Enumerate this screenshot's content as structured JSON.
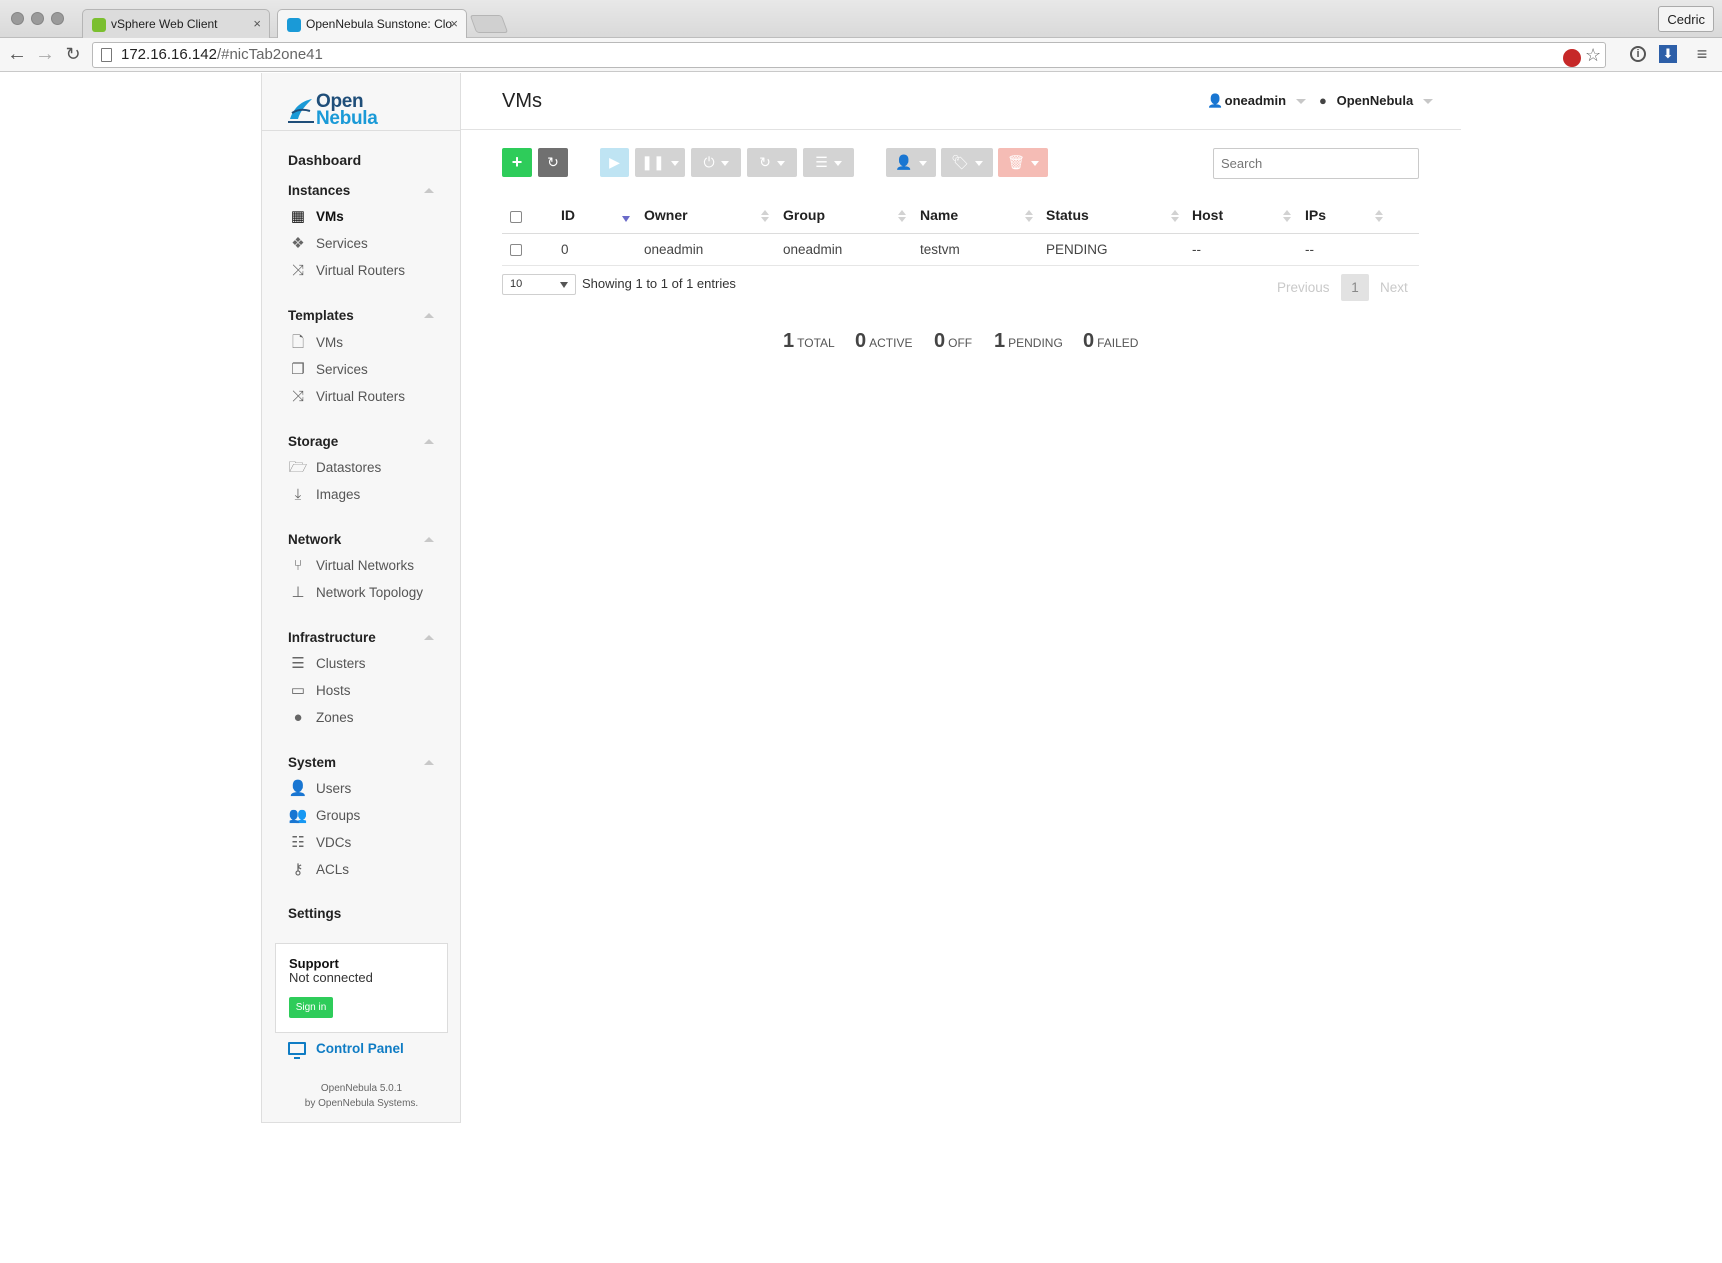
{
  "browser": {
    "tabs": [
      {
        "title": "vSphere Web Client",
        "active": false,
        "favicon_color": "#7bbf2f"
      },
      {
        "title": "OpenNebula Sunstone: Clo",
        "active": true,
        "favicon_color": "#1a9ad7"
      }
    ],
    "profile": "Cedric",
    "url_host": "172.16.16.142",
    "url_path": "/#nicTab2one41"
  },
  "sidebar": {
    "logo_line1": "Open",
    "logo_line2": "Nebula",
    "dashboard": "Dashboard",
    "sections": [
      {
        "title": "Instances",
        "items": [
          {
            "label": "VMs",
            "icon": "grid-icon",
            "selected": true
          },
          {
            "label": "Services",
            "icon": "cubes-icon"
          },
          {
            "label": "Virtual Routers",
            "icon": "random-icon"
          }
        ]
      },
      {
        "title": "Templates",
        "items": [
          {
            "label": "VMs",
            "icon": "file-icon"
          },
          {
            "label": "Services",
            "icon": "files-icon"
          },
          {
            "label": "Virtual Routers",
            "icon": "random-icon"
          }
        ]
      },
      {
        "title": "Storage",
        "items": [
          {
            "label": "Datastores",
            "icon": "folder-open-icon"
          },
          {
            "label": "Images",
            "icon": "download-icon"
          }
        ]
      },
      {
        "title": "Network",
        "items": [
          {
            "label": "Virtual Networks",
            "icon": "code-fork-icon"
          },
          {
            "label": "Network Topology",
            "icon": "sitemap-icon"
          }
        ]
      },
      {
        "title": "Infrastructure",
        "items": [
          {
            "label": "Clusters",
            "icon": "server-icon"
          },
          {
            "label": "Hosts",
            "icon": "hdd-icon"
          },
          {
            "label": "Zones",
            "icon": "globe-icon"
          }
        ]
      },
      {
        "title": "System",
        "items": [
          {
            "label": "Users",
            "icon": "user-icon"
          },
          {
            "label": "Groups",
            "icon": "users-icon"
          },
          {
            "label": "VDCs",
            "icon": "list-icon"
          },
          {
            "label": "ACLs",
            "icon": "key-icon"
          }
        ]
      }
    ],
    "settings": "Settings",
    "support": {
      "title": "Support",
      "status": "Not connected",
      "signin": "Sign in"
    },
    "control_panel": "Control Panel",
    "version_line1": "OpenNebula 5.0.1",
    "version_by": "by",
    "version_company": "OpenNebula Systems."
  },
  "header": {
    "title": "VMs",
    "user": "oneadmin",
    "zone": "OpenNebula"
  },
  "toolbar": {
    "search_placeholder": "Search",
    "colors": {
      "create": "#2ecc5a",
      "refresh": "#707070",
      "play": "#bfe4f3",
      "disabled": "#d3d3d3",
      "delete": "#f5bcb5"
    }
  },
  "table": {
    "columns": [
      "ID",
      "Owner",
      "Group",
      "Name",
      "Status",
      "Host",
      "IPs"
    ],
    "rows": [
      {
        "id": "0",
        "owner": "oneadmin",
        "group": "oneadmin",
        "name": "testvm",
        "status": "PENDING",
        "host": "--",
        "ips": "--"
      }
    ],
    "page_length": "10",
    "info": "Showing 1 to 1 of 1 entries",
    "previous": "Previous",
    "current_page": "1",
    "next": "Next"
  },
  "stats": [
    {
      "value": "1",
      "label": "TOTAL"
    },
    {
      "value": "0",
      "label": "ACTIVE"
    },
    {
      "value": "0",
      "label": "OFF"
    },
    {
      "value": "1",
      "label": "PENDING"
    },
    {
      "value": "0",
      "label": "FAILED"
    }
  ]
}
